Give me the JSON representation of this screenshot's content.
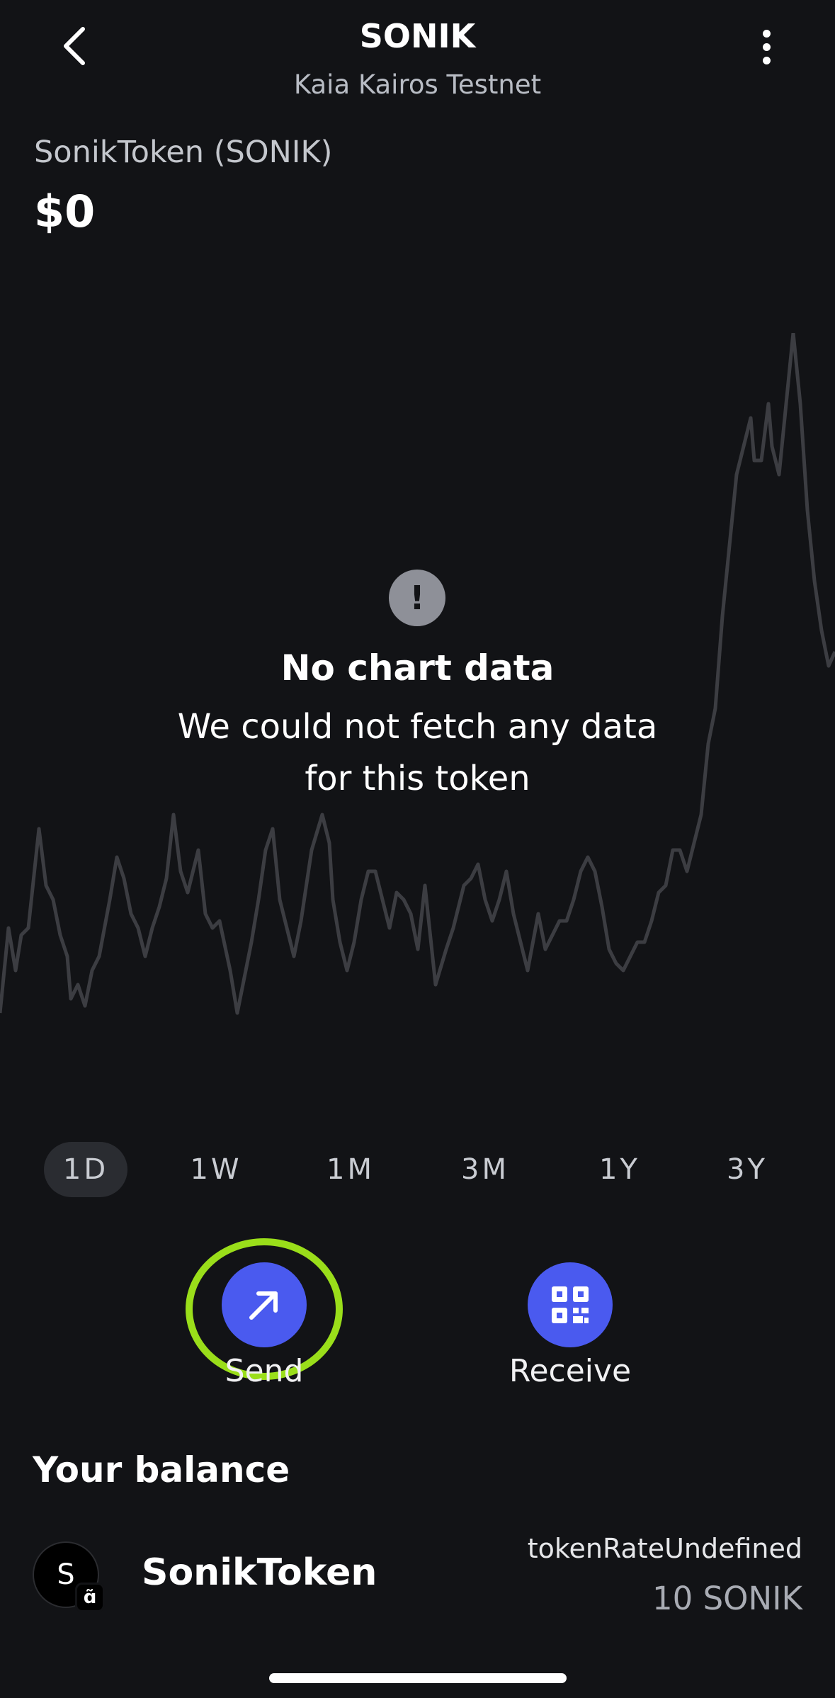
{
  "header": {
    "title": "SONIK",
    "subtitle": "Kaia Kairos Testnet",
    "back_icon": "chevron-left-icon",
    "more_icon": "vertical-dots-icon"
  },
  "token": {
    "name": "SonikToken (SONIK)",
    "value": "$0"
  },
  "chart_state": {
    "icon": "exclamation-icon",
    "title": "No chart data",
    "message": "We could not fetch any data for this token"
  },
  "ranges": {
    "items": [
      "1D",
      "1W",
      "1M",
      "3M",
      "1Y",
      "3Y"
    ],
    "selected": "1D"
  },
  "actions": {
    "send_label": "Send",
    "receive_label": "Receive"
  },
  "balance": {
    "title": "Your balance",
    "avatar_letter": "S",
    "badge_glyph": "ɑ̃",
    "token_name": "SonikToken",
    "rate": "tokenRateUndefined",
    "amount": "10 SONIK"
  },
  "colors": {
    "background": "#121316",
    "accent": "#4a5aef",
    "highlight": "#9ade1a"
  }
}
